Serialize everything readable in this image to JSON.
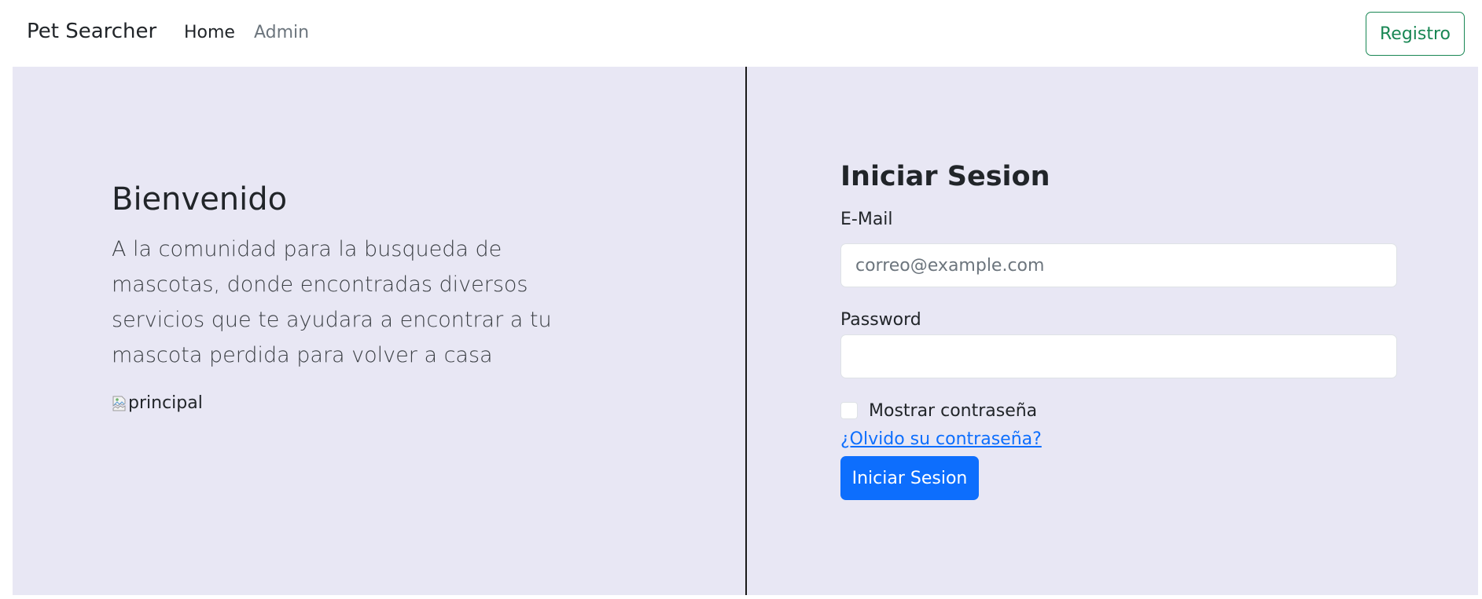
{
  "navbar": {
    "brand": "Pet Searcher",
    "links": [
      {
        "label": "Home",
        "active": true
      },
      {
        "label": "Admin",
        "active": false
      }
    ],
    "register_label": "Registro"
  },
  "welcome": {
    "title": "Bienvenido",
    "description": "A la comunidad para la busqueda de mascotas, donde encontradas diversos servicios que te ayudara a encontrar a tu mascota perdida para volver a casa",
    "image_alt": "principal"
  },
  "login": {
    "title": "Iniciar Sesion",
    "email_label": "E-Mail",
    "email_placeholder": "correo@example.com",
    "email_value": "",
    "password_label": "Password",
    "password_value": "",
    "show_password_label": "Mostrar contraseña",
    "show_password_checked": false,
    "forgot_label": "¿Olvido su contraseña?",
    "submit_label": "Iniciar Sesion"
  },
  "colors": {
    "panel_background": "#e8e7f4",
    "primary": "#0d6efd",
    "success": "#198754",
    "muted": "#6c757d"
  },
  "icons": {
    "image_alt_icon": "broken-image-icon"
  }
}
